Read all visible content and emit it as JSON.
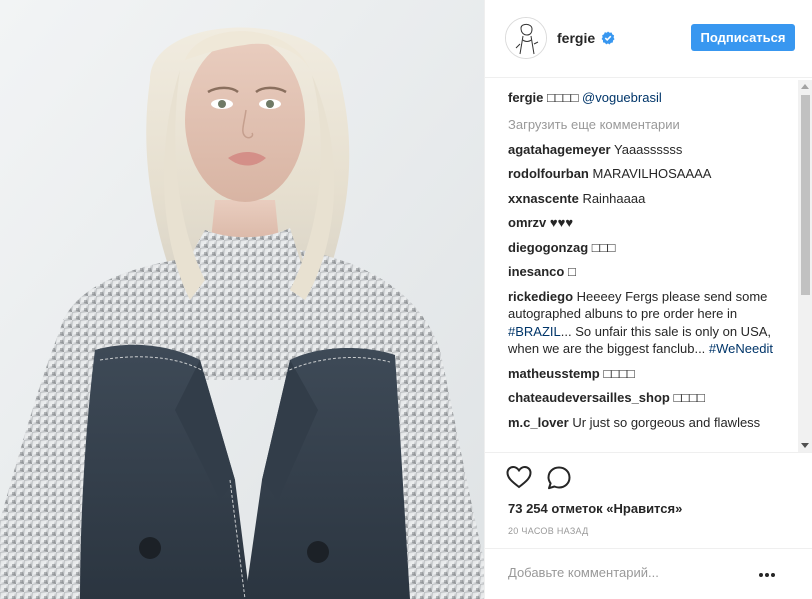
{
  "post": {
    "username": "fergie",
    "follow_label": "Подписаться",
    "caption": {
      "user": "fergie",
      "text": " □□□□ ",
      "mention": "@voguebrasil"
    },
    "load_more": "Загрузить еще комментарии",
    "comments": [
      {
        "user": "agatahagemeyer",
        "text": " Yaaassssss"
      },
      {
        "user": "rodolfourban",
        "text": " MARAVILHOSAAAA"
      },
      {
        "user": "xxnascente",
        "text": " Rainhaaaa"
      },
      {
        "user": "omrzv",
        "text": " ♥♥♥"
      },
      {
        "user": "diegogonzag",
        "text": " □□□"
      },
      {
        "user": "inesanco",
        "text": " □"
      },
      {
        "user": "rickediego",
        "text_a": " Heeeey Fergs please send some autographed albuns to pre order here in ",
        "tag1": "#BRAZIL",
        "text_b": "... So unfair this sale is only on USA, when we are the biggest fanclub... ",
        "tag2": "#WeNeedit"
      },
      {
        "user": "matheusstemp",
        "text": " □□□□"
      },
      {
        "user": "chateaudeversailles_shop",
        "text": " □□□□"
      },
      {
        "user": "m.c_lover",
        "text": " Ur just so gorgeous and flawless"
      }
    ],
    "likes": "73 254 отметок «Нравится»",
    "time": "20 ЧАСОВ НАЗАД",
    "add_comment_placeholder": "Добавьте комментарий..."
  },
  "icons": {
    "verified": "verified-badge-icon",
    "like": "heart-icon",
    "comment": "comment-bubble-icon",
    "more": "more-options-icon"
  },
  "colors": {
    "accent": "#3897f0",
    "link": "#003569",
    "muted": "#999999",
    "text": "#262626"
  }
}
